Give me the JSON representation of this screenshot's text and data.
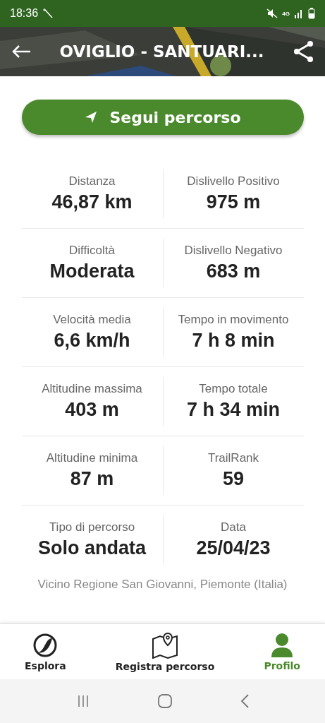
{
  "status_bar": {
    "time": "18:36",
    "network": "4G"
  },
  "header": {
    "title": "OVIGLIO - SANTUARI..."
  },
  "follow_button": {
    "label": "Segui percorso"
  },
  "stats": [
    [
      {
        "label": "Distanza",
        "value": "46,87 km"
      },
      {
        "label": "Dislivello Positivo",
        "value": "975 m"
      }
    ],
    [
      {
        "label": "Difficoltà",
        "value": "Moderata"
      },
      {
        "label": "Dislivello Negativo",
        "value": "683 m"
      }
    ],
    [
      {
        "label": "Velocità media",
        "value": "6,6 km/h"
      },
      {
        "label": "Tempo in movimento",
        "value": "7 h 8 min"
      }
    ],
    [
      {
        "label": "Altitudine massima",
        "value": "403 m"
      },
      {
        "label": "Tempo totale",
        "value": "7 h 34 min"
      }
    ],
    [
      {
        "label": "Altitudine minima",
        "value": "87 m"
      },
      {
        "label": "TrailRank",
        "value": "59"
      }
    ],
    [
      {
        "label": "Tipo di percorso",
        "value": "Solo andata"
      },
      {
        "label": "Data",
        "value": "25/04/23"
      }
    ]
  ],
  "location": "Vicino Regione San Giovanni, Piemonte (Italia)",
  "bottom_nav": [
    {
      "label": "Esplora",
      "kind": "explore",
      "selected": false
    },
    {
      "label": "Registra percorso",
      "kind": "record",
      "selected": false
    },
    {
      "label": "Profilo",
      "kind": "profile",
      "selected": true
    }
  ]
}
